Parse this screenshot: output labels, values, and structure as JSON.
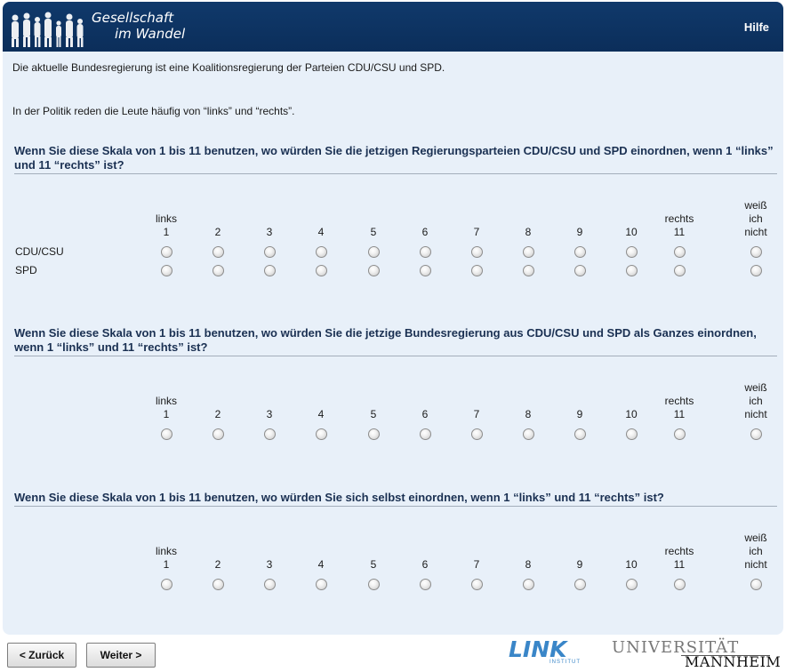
{
  "header": {
    "logo_line1": "Gesellschaft",
    "logo_line2": "im Wandel",
    "help_label": "Hilfe",
    "background": "#0d3463"
  },
  "intro": {
    "text1": "Die aktuelle Bundesregierung ist eine Koalitionsregierung der Parteien CDU/CSU und SPD.",
    "text2": "In der Politik reden die Leute häufig von “links” und “rechts”."
  },
  "scale": {
    "columns": [
      {
        "top": "links",
        "num": "1"
      },
      {
        "top": "",
        "num": "2"
      },
      {
        "top": "",
        "num": "3"
      },
      {
        "top": "",
        "num": "4"
      },
      {
        "top": "",
        "num": "5"
      },
      {
        "top": "",
        "num": "6"
      },
      {
        "top": "",
        "num": "7"
      },
      {
        "top": "",
        "num": "8"
      },
      {
        "top": "",
        "num": "9"
      },
      {
        "top": "",
        "num": "10"
      },
      {
        "top": "rechts",
        "num": "11"
      }
    ],
    "dontknow": {
      "line1": "weiß",
      "line2": "ich",
      "line3": "nicht"
    }
  },
  "questions": [
    {
      "text": "Wenn Sie diese Skala von 1 bis 11 benutzen, wo würden Sie die jetzigen Regierungsparteien CDU/CSU und SPD einordnen, wenn 1 “links” und 11 “rechts” ist?",
      "rows": [
        "CDU/CSU",
        "SPD"
      ]
    },
    {
      "text": "Wenn Sie diese Skala von 1 bis 11 benutzen, wo würden Sie die jetzige Bundesregierung aus CDU/CSU und SPD als Ganzes einordnen, wenn 1 “links” und 11 “rechts” ist?",
      "rows": [
        ""
      ]
    },
    {
      "text": "Wenn Sie diese Skala von 1 bis 11 benutzen, wo würden Sie sich selbst einordnen, wenn 1 “links” und 11 “rechts” ist?",
      "rows": [
        ""
      ]
    }
  ],
  "nav": {
    "back_label": "< Zurück",
    "next_label": "Weiter >"
  },
  "footer": {
    "link_logo": "LINK",
    "link_sub": "INSTITUT",
    "uni_line1": "UNIVERSITÄT",
    "uni_line2": "MANNHEIM"
  }
}
